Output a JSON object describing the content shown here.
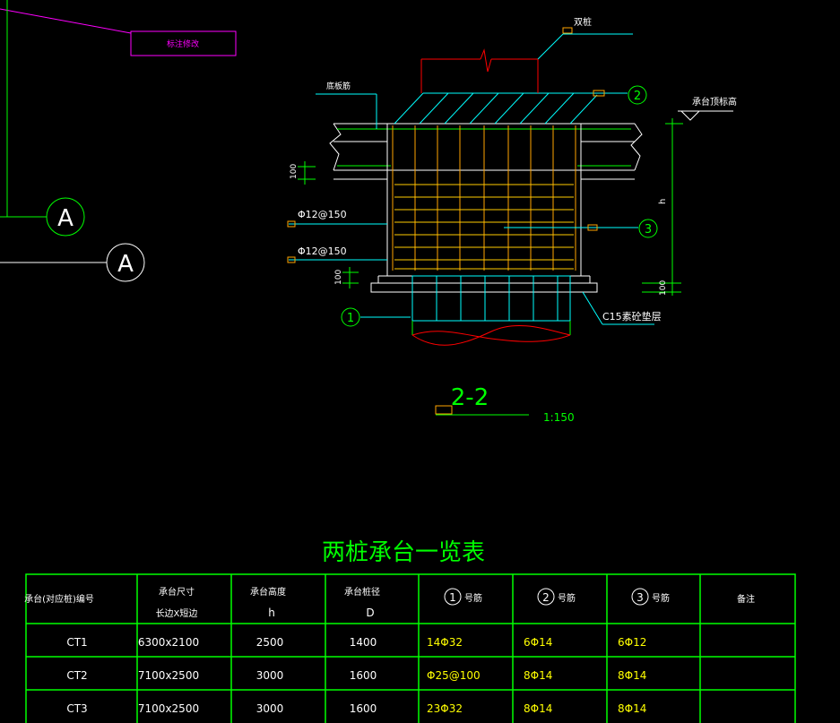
{
  "colors": {
    "background": "#000000",
    "green": "#00ff00",
    "cyan": "#00ffff",
    "yellow": "#ffff00",
    "orange": "#ffa500",
    "red": "#ff0000",
    "magenta": "#ff00ff",
    "white": "#ffffff"
  },
  "labels": {
    "leader_note": "标注修改",
    "grid_a1": "A",
    "grid_a2": "A",
    "double_pile": "双桩",
    "bottom_rebar": "底板筋",
    "cap_top_elev": "承台顶标高",
    "dim_100_top": "100",
    "dim_100_bottom": "100",
    "dim_100_right": "100",
    "dim_h": "h",
    "rebar_1": "Φ12@150",
    "rebar_2": "Φ12@150",
    "c15": "C15素砼垫层",
    "bubble_1": "1",
    "bubble_2": "2",
    "bubble_3": "3",
    "section_title": "2-2",
    "scale": "1:150"
  },
  "table": {
    "title": "两桩承台一览表",
    "headers": [
      {
        "line1": "承台(对应桩)编号",
        "line2": ""
      },
      {
        "line1": "承台尺寸",
        "line2": "长边X短边"
      },
      {
        "line1": "承台高度",
        "line2": "h"
      },
      {
        "line1": "承台桩径",
        "line2": "D"
      },
      {
        "num": "1",
        "suffix": "号筋"
      },
      {
        "num": "2",
        "suffix": "号筋"
      },
      {
        "num": "3",
        "suffix": "号筋"
      },
      {
        "line1": "备注",
        "line2": ""
      }
    ],
    "rows": [
      [
        "CT1",
        "6300x2100",
        "2500",
        "1400",
        "14Φ32",
        "6Φ14",
        "6Φ12",
        ""
      ],
      [
        "CT2",
        "7100x2500",
        "3000",
        "1600",
        "Φ25@100",
        "8Φ14",
        "8Φ14",
        ""
      ],
      [
        "CT3",
        "7100x2500",
        "3000",
        "1600",
        "23Φ32",
        "8Φ14",
        "8Φ14",
        ""
      ]
    ]
  }
}
